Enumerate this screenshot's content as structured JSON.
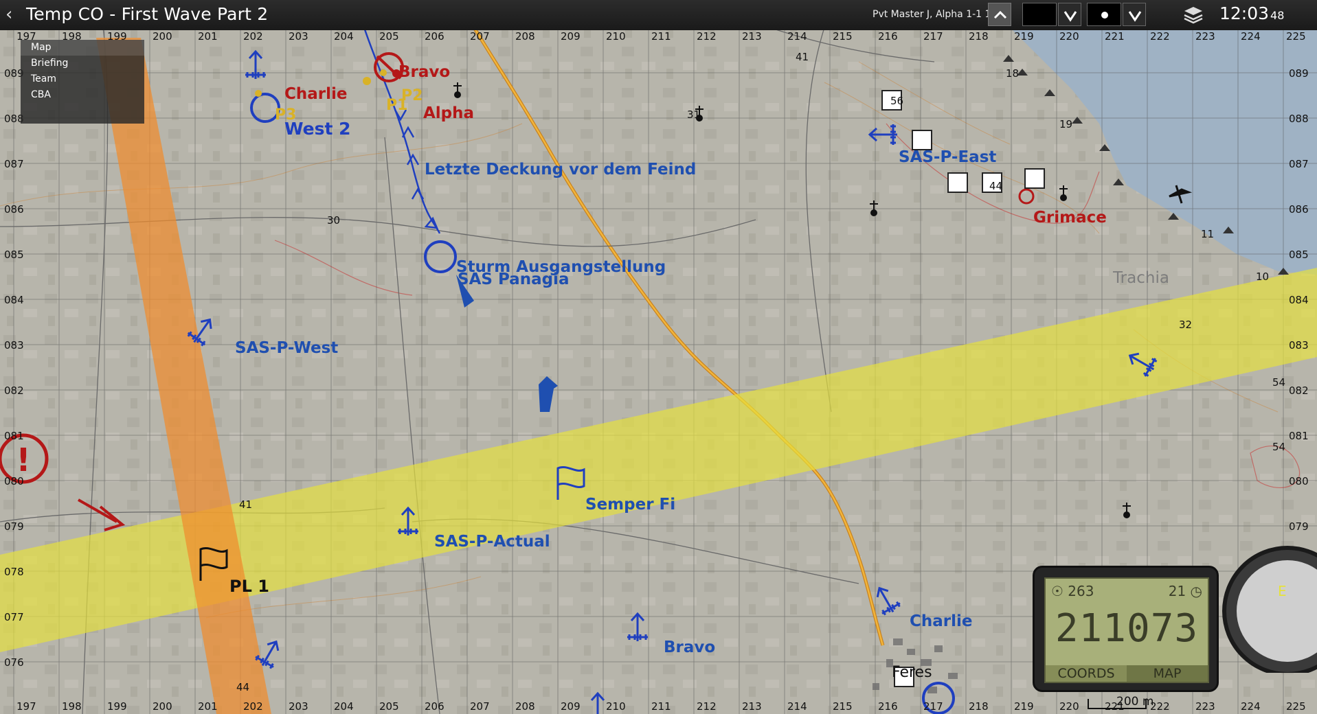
{
  "window": {
    "title": "Temp CO - First Wave Part 2",
    "player": "Pvt Master J, Alpha 1-1 1"
  },
  "clock": {
    "hm": "12:03",
    "sec": "48"
  },
  "menu": {
    "items": [
      "Map",
      "Briefing",
      "Team",
      "CBA"
    ]
  },
  "grid": {
    "top_labels": [
      "197",
      "198",
      "199",
      "200",
      "201",
      "202",
      "203",
      "204",
      "205",
      "206",
      "207",
      "208",
      "209",
      "210",
      "211",
      "212",
      "213",
      "214",
      "215",
      "216",
      "217",
      "218",
      "219",
      "220",
      "221",
      "222",
      "223",
      "224",
      "225"
    ],
    "bottom_labels": [
      "197",
      "198",
      "199",
      "200",
      "201",
      "202",
      "203",
      "204",
      "205",
      "206",
      "207",
      "208",
      "209",
      "210",
      "211",
      "212",
      "213",
      "214",
      "215",
      "216",
      "217",
      "218",
      "219",
      "220",
      "221",
      "222",
      "223",
      "224",
      "225"
    ],
    "left_labels": [
      "089",
      "088",
      "087",
      "086",
      "085",
      "084",
      "083",
      "082",
      "081",
      "080",
      "079",
      "078",
      "077",
      "076"
    ],
    "right_labels": [
      "089",
      "088",
      "087",
      "086",
      "085",
      "084",
      "083",
      "082",
      "081",
      "080",
      "079",
      "078",
      "077",
      "076"
    ]
  },
  "markers": {
    "charlie_nw": "Charlie",
    "bravo_n": "Bravo",
    "alpha": "Alpha",
    "west2": "West 2",
    "p1": "P1",
    "p2": "P2",
    "p3": "P3",
    "letzte": "Letzte Deckung vor dem Feind",
    "sturm": "Sturm Ausgangstellung",
    "panagia": "SAS Panagia",
    "sas_p_west": "SAS-P-West",
    "sas_p_east": "SAS-P-East",
    "grimace": "Grimace",
    "trachia": "Trachia",
    "semper": "Semper Fi",
    "sas_p_actual": "SAS-P-Actual",
    "pl1": "PL 1",
    "charlie_se": "Charlie",
    "bravo_s": "Bravo",
    "feres": "Feres"
  },
  "elevations": [
    "30",
    "41",
    "41",
    "31",
    "18",
    "19",
    "11",
    "10",
    "32",
    "54",
    "54",
    "44",
    "56",
    "44"
  ],
  "gps": {
    "heading": "263",
    "speed": "21",
    "coords": "211073",
    "tab_coords": "COORDS",
    "tab_map": "MAP"
  },
  "scale": "200 m",
  "colors": {
    "blufor": "#1f3fbf",
    "opfor": "#b41818",
    "yellow_phase": "#e6e23c",
    "orange_phase": "#f08c2c",
    "sea": "#9fb2c4"
  }
}
